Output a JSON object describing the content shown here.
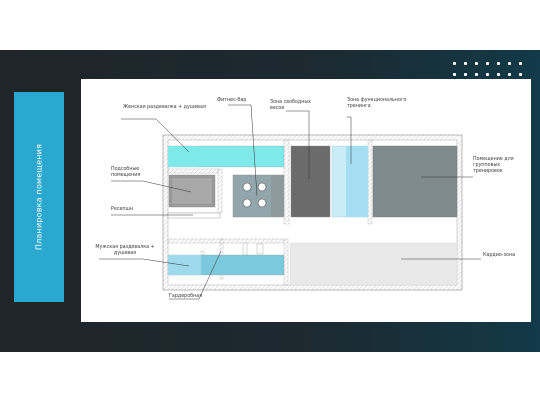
{
  "slide": {
    "side_title": "Планировка помещения",
    "colors": {
      "dark_bg": "#1f2529",
      "accent": "#2aa8cf",
      "cyan_room": "#7fe8e8",
      "light_blue_room": "#9fd9ec",
      "dark_room": "#6b6b6b",
      "medium_room": "#7f8a8c",
      "light_room": "#e9e9e9"
    },
    "labels": {
      "women_locker": "Женская раздевалка + душевая",
      "fitness_bar": "Фитнес-бар",
      "free_weights": "Зона свободных весов",
      "functional": "Зона функционального тренинга",
      "group_room": "Помещение для групповых тренировок",
      "utility": "Подсобные помещения",
      "reception": "Ресепшн",
      "men_locker": "Мужская раздевалка + душевая",
      "cardio": "Кардио-зона",
      "wardrobe": "Гардеробная"
    }
  }
}
